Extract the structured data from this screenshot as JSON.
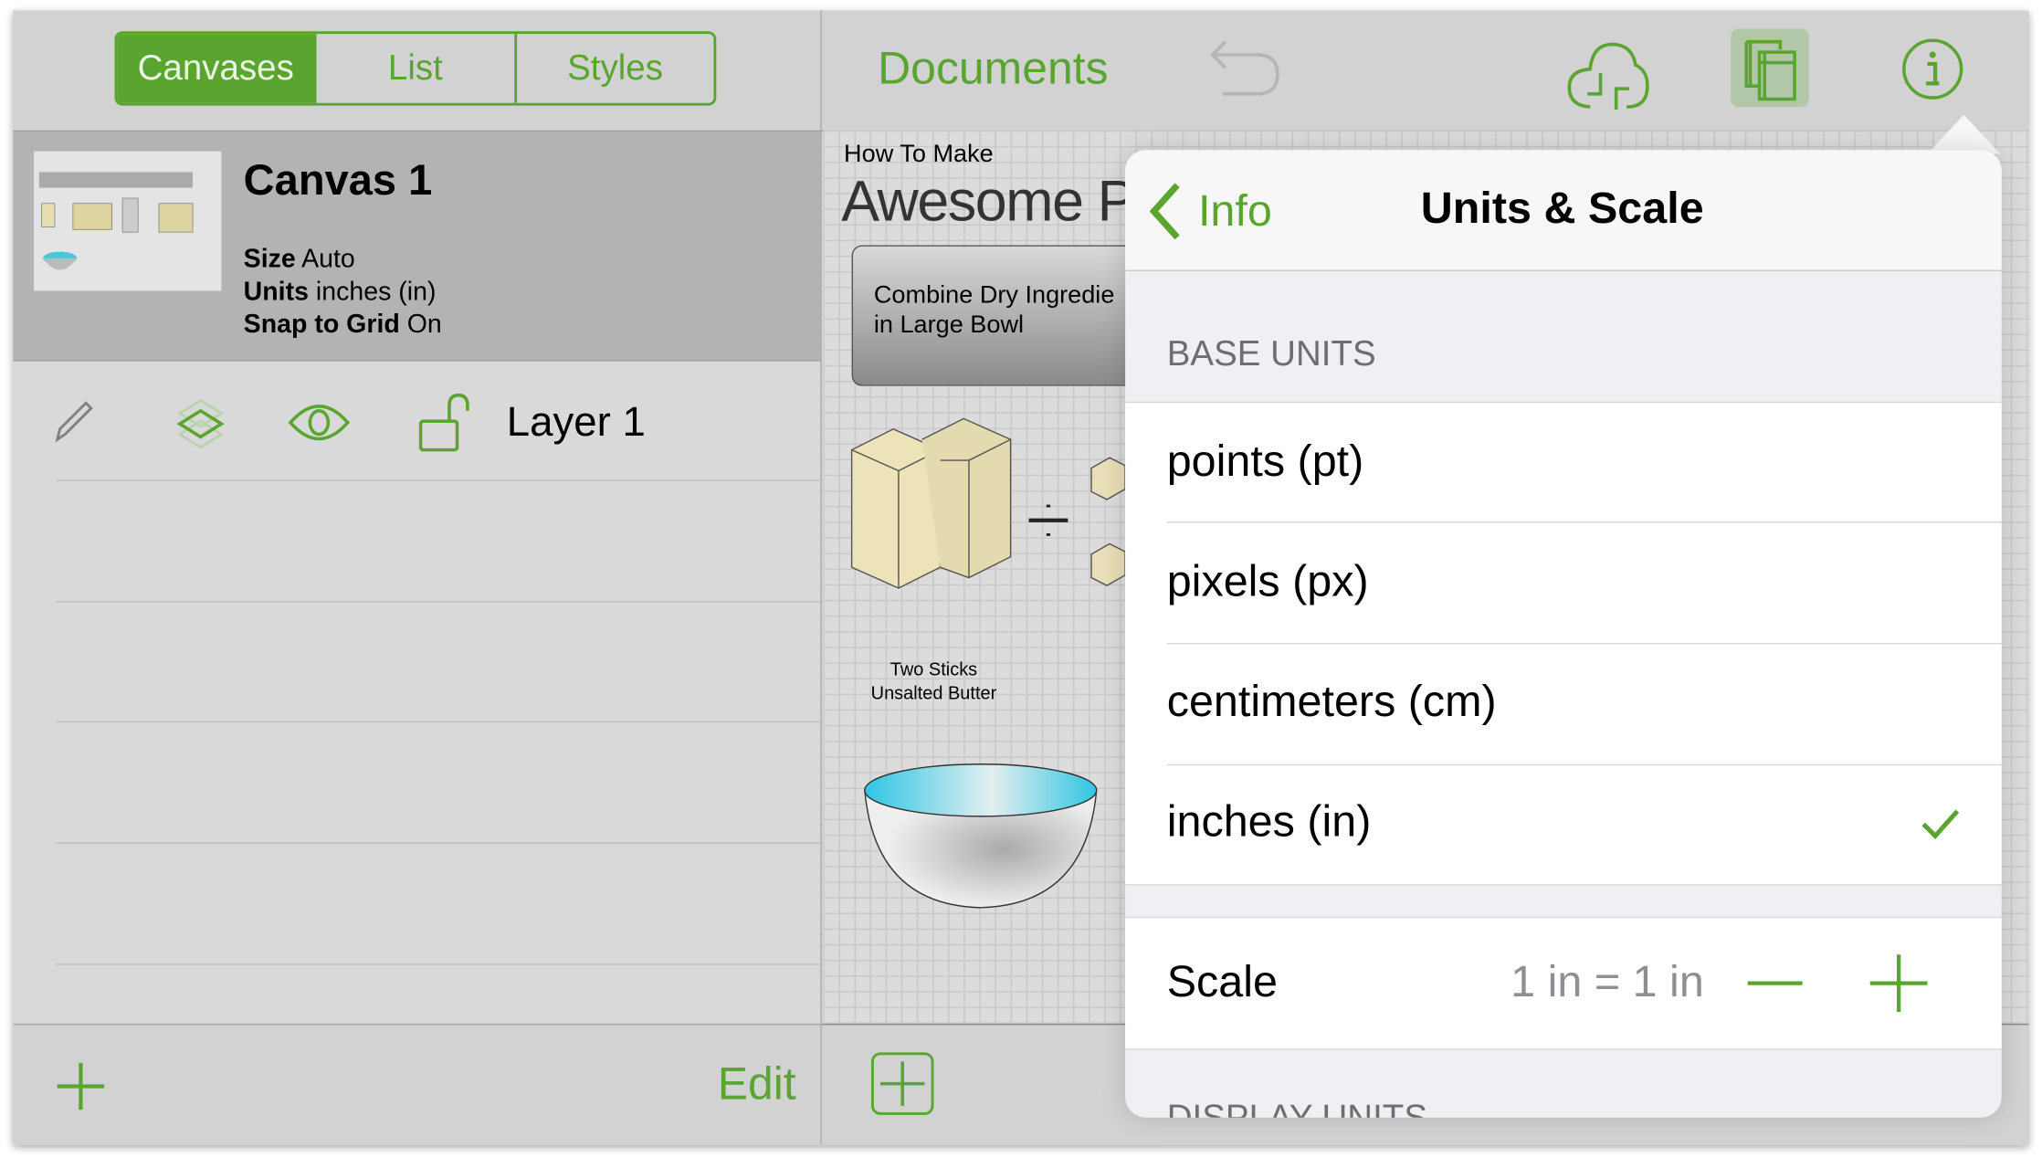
{
  "left_toolbar": {
    "tabs": [
      {
        "label": "Canvases",
        "selected": true
      },
      {
        "label": "List",
        "selected": false
      },
      {
        "label": "Styles",
        "selected": false
      }
    ]
  },
  "canvas_item": {
    "title": "Canvas 1",
    "size_label": "Size",
    "size_value": "Auto",
    "units_label": "Units",
    "units_value": "inches (in)",
    "snap_label": "Snap to Grid",
    "snap_value": "On"
  },
  "layer": {
    "name": "Layer 1",
    "icons": [
      "pencil-icon",
      "layers-icon",
      "eye-icon",
      "unlock-icon"
    ]
  },
  "left_bottom": {
    "add_icon": "plus-icon",
    "edit_label": "Edit"
  },
  "right_toolbar": {
    "documents_label": "Documents",
    "icons": [
      "undo-icon",
      "cloud-sync-icon",
      "canvases-icon",
      "info-icon"
    ]
  },
  "canvas": {
    "heading_small": "How To Make",
    "heading_large": "Awesome P",
    "step_box": "Combine Dry Ingredie\nin Large Bowl",
    "butter_caption_1": "Two Sticks",
    "butter_caption_2": "Unsalted Butter"
  },
  "popover": {
    "back_label": "Info",
    "title": "Units & Scale",
    "section_base": "BASE UNITS",
    "units": [
      {
        "label": "points (pt)",
        "checked": false
      },
      {
        "label": "pixels (px)",
        "checked": false
      },
      {
        "label": "centimeters (cm)",
        "checked": false
      },
      {
        "label": "inches (in)",
        "checked": true
      }
    ],
    "scale_label": "Scale",
    "scale_value": "1 in = 1 in",
    "section_display": "DISPLAY UNITS"
  },
  "colors": {
    "accent": "#5aa52f",
    "selected_row": "#b3b3b3",
    "toolbar": "#d2d2d2"
  }
}
